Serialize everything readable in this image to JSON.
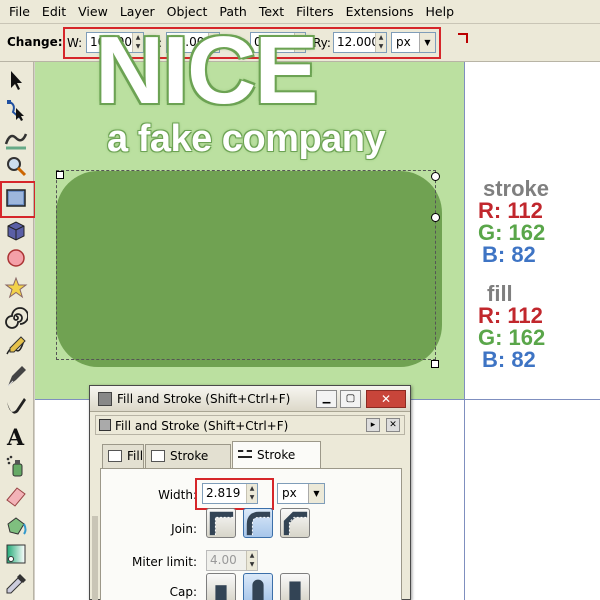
{
  "menu": [
    "File",
    "Edit",
    "View",
    "Layer",
    "Object",
    "Path",
    "Text",
    "Filters",
    "Extensions",
    "Help"
  ],
  "controls": {
    "label": "Change:",
    "w_label": "W:",
    "w_value": "108.000",
    "h_label": "H:",
    "h_value": "54.000",
    "rx_label": "Rx:",
    "rx_value": "0.000",
    "ry_label": "Ry:",
    "ry_value": "12.000",
    "unit": "px"
  },
  "canvas": {
    "brand_big": "NICE",
    "brand_sub": "a fake company",
    "stroke": {
      "title": "stroke",
      "r": "R: 112",
      "g": "G: 162",
      "b": "B: 82"
    },
    "fill": {
      "title": "fill",
      "r": "R: 112",
      "g": "G: 162",
      "b": "B: 82"
    },
    "colors": {
      "page": "#bbe0a0",
      "rect": "#70a252",
      "red": "#c1272d",
      "green": "#5aa64a",
      "blue": "#3e74c4",
      "grey": "#7f7f7f"
    }
  },
  "dialog": {
    "title": "Fill and Stroke (Shift+Ctrl+F)",
    "dock_title": "Fill and Stroke (Shift+Ctrl+F)",
    "tabs": [
      "Fill",
      "Stroke paint",
      "Stroke style"
    ],
    "width_label": "Width:",
    "width_value": "2.819",
    "width_unit": "px",
    "join_label": "Join:",
    "miter_label": "Miter limit:",
    "miter_value": "4.00",
    "cap_label": "Cap:"
  },
  "tools": [
    "selector-tool-icon",
    "node-tool-icon",
    "tweak-tool-icon",
    "zoom-tool-icon",
    "rectangle-tool-icon",
    "3dbox-tool-icon",
    "ellipse-tool-icon",
    "star-tool-icon",
    "spiral-tool-icon",
    "pencil-tool-icon",
    "pen-tool-icon",
    "calligraphy-tool-icon",
    "text-tool-icon",
    "spray-tool-icon",
    "eraser-tool-icon",
    "bucket-tool-icon",
    "gradient-tool-icon",
    "dropper-tool-icon"
  ]
}
